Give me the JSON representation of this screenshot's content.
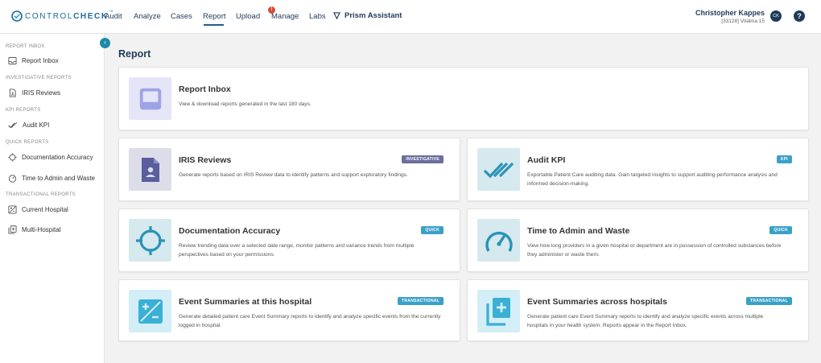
{
  "header": {
    "logo_text_1": "CONTROL",
    "logo_text_2": "CHECK",
    "logo_tm": "™",
    "nav": [
      {
        "label": "Audit"
      },
      {
        "label": "Analyze"
      },
      {
        "label": "Cases"
      },
      {
        "label": "Report"
      },
      {
        "label": "Upload"
      },
      {
        "label": "Manage"
      },
      {
        "label": "Labs"
      }
    ],
    "manage_badge": "!",
    "prism_label": "Prism Assistant",
    "user_name": "Christopher Kappes",
    "user_sub": "[33128] Vitalina 15",
    "avatar_initials": "CK",
    "help_label": "?"
  },
  "sidebar": {
    "sections": [
      {
        "title": "REPORT INBOX",
        "items": [
          {
            "label": "Report Inbox",
            "icon": "inbox-icon"
          }
        ]
      },
      {
        "title": "INVESTIGATIVE REPORTS",
        "items": [
          {
            "label": "IRIS Reviews",
            "icon": "document-icon"
          }
        ]
      },
      {
        "title": "KPI REPORTS",
        "items": [
          {
            "label": "Audit KPI",
            "icon": "double-check-icon"
          }
        ]
      },
      {
        "title": "QUICK REPORTS",
        "items": [
          {
            "label": "Documentation Accuracy",
            "icon": "crosshair-icon"
          },
          {
            "label": "Time to Admin and Waste",
            "icon": "gauge-icon"
          }
        ]
      },
      {
        "title": "TRANSACTIONAL REPORTS",
        "items": [
          {
            "label": "Current Hospital",
            "icon": "plus-minus-icon"
          },
          {
            "label": "Multi-Hospital",
            "icon": "stacked-docs-icon"
          }
        ]
      }
    ],
    "collapse_glyph": "‹"
  },
  "main": {
    "title": "Report",
    "cards": [
      {
        "title": "Report Inbox",
        "desc": "View & download reports generated in the last 180 days.",
        "tag": ""
      },
      {
        "title": "IRIS Reviews",
        "desc": "Generate reports based on IRIS Review data to identify patterns and support exploratory findings.",
        "tag": "INVESTIGATIVE"
      },
      {
        "title": "Audit KPI",
        "desc": "Exportable Patient Care auditing data. Gain targeted insights to support auditing performance analysis and informed decision-making.",
        "tag": "KPI"
      },
      {
        "title": "Documentation Accuracy",
        "desc": "Review trending data over a selected date range, monitor patterns and variance trends from multiple perspectives based on your permissions.",
        "tag": "QUICK"
      },
      {
        "title": "Time to Admin and Waste",
        "desc": "View how long providers in a given hospital or department are in possession of controlled substances before they administer or waste them.",
        "tag": "QUICK"
      },
      {
        "title": "Event Summaries at this hospital",
        "desc": "Generate detailed patient care Event Summary reports to identify and analyze specific events from the currently logged in hospital.",
        "tag": "TRANSACTIONAL"
      },
      {
        "title": "Event Summaries across hospitals",
        "desc": "Generate patient care Event Summary reports to identify and analyze specific events across multiple hospitals in your health system. Reports appear in the Report Inbox.",
        "tag": "TRANSACTIONAL"
      }
    ]
  },
  "colors": {
    "brand": "#1a6a9a",
    "nav_text": "#1f3b5a",
    "tag_investigative": "#6b6f9e",
    "tag_blue": "#3aa0c8",
    "icon_purple": "#5a5e9e",
    "icon_teal": "#2a93b8"
  }
}
